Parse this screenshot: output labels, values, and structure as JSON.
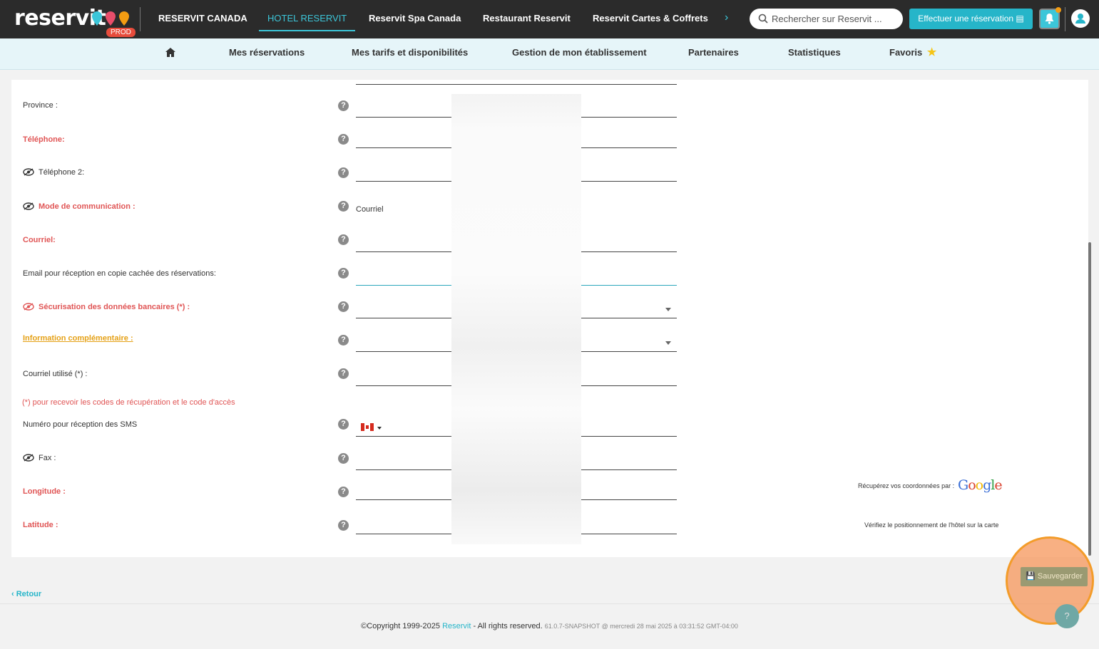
{
  "header": {
    "logo_text": "reservit",
    "env_badge": "PROD",
    "nav": [
      {
        "label": "RESERVIT CANADA"
      },
      {
        "label": "HOTEL RESERVIT"
      },
      {
        "label": "Reservit Spa Canada"
      },
      {
        "label": "Restaurant Reservit"
      },
      {
        "label": "Reservit Cartes & Coffrets"
      }
    ],
    "search_placeholder": "Rechercher sur Reservit ...",
    "booking_button": "Effectuer une réservation"
  },
  "subnav": {
    "items": [
      {
        "label": "Mes réservations"
      },
      {
        "label": "Mes tarifs et disponibilités"
      },
      {
        "label": "Gestion de mon établissement"
      },
      {
        "label": "Partenaires"
      },
      {
        "label": "Statistiques"
      },
      {
        "label": "Favoris"
      }
    ]
  },
  "form": {
    "fields": [
      {
        "label": "Province :"
      },
      {
        "label": "Téléphone:"
      },
      {
        "label": "Téléphone 2:"
      },
      {
        "label": "Mode de communication :",
        "value": "Courriel"
      },
      {
        "label": "Courriel:"
      },
      {
        "label": "Email pour réception en copie cachée des réservations:"
      },
      {
        "label": "Sécurisation des données bancaires (*) :"
      },
      {
        "label": "Information complémentaire :"
      },
      {
        "label": "Courriel utilisé (*) :"
      },
      {
        "label": "Numéro pour réception des SMS"
      },
      {
        "label": "Fax :"
      },
      {
        "label": "Longitude :"
      },
      {
        "label": "Latitude :"
      }
    ],
    "note": "(*) pour recevoir les codes de récupération et le code d'accès",
    "google_text": "Récupérez vos coordonnées par :",
    "google_logo": "Google",
    "verify_text": "Vérifiez le positionnement de l'hôtel sur la carte",
    "help_glyph": "?"
  },
  "actions": {
    "save_button": "Sauvegarder",
    "back_link": "Retour"
  },
  "footer": {
    "copyright": "©Copyright 1999-2025",
    "brand": "Reservit",
    "rights": "- All rights reserved.",
    "version": "61.0.7-SNAPSHOT @ mercredi 28 mai 2025 à 03:31:52 GMT-04:00"
  },
  "colors": {
    "accent": "#26b5c9",
    "required": "#e05555",
    "info": "#e5a117",
    "topbar": "#2b2b2b"
  }
}
